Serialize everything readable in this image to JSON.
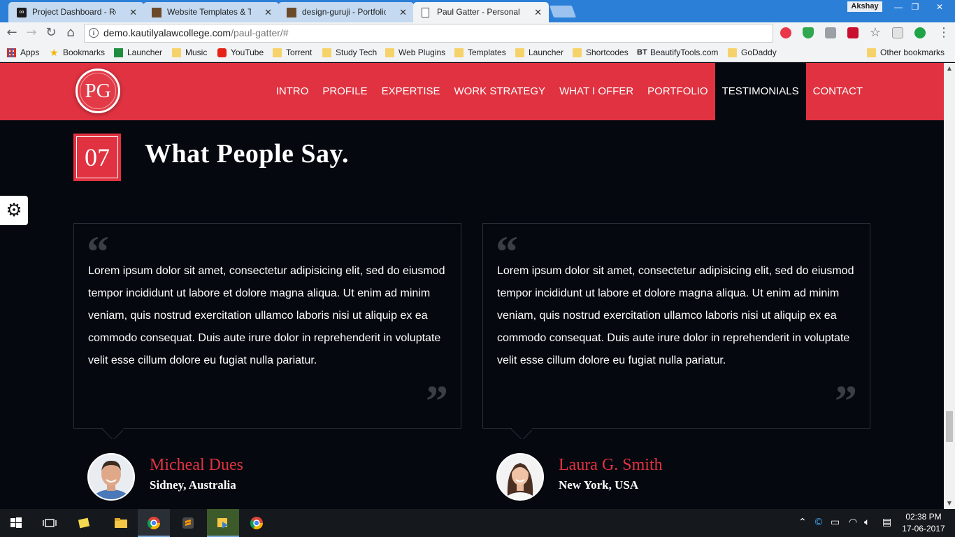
{
  "browser": {
    "tabs": [
      {
        "title": "Project Dashboard - Rob"
      },
      {
        "title": "Website Templates & Th"
      },
      {
        "title": "design-guruji - Portfolio"
      },
      {
        "title": "Paul Gatter - Personal Re"
      }
    ],
    "profile": "Akshay",
    "url_host": "demo.kautilyalawcollege.com",
    "url_path": "/paul-gatter/#",
    "bookmarks": [
      "Apps",
      "Bookmarks",
      "Launcher",
      "Music",
      "YouTube",
      "Torrent",
      "Study Tech",
      "Web Plugins",
      "Templates",
      "Launcher",
      "Shortcodes",
      "BeautifyTools.com",
      "GoDaddy"
    ],
    "other_bookmarks": "Other bookmarks"
  },
  "site": {
    "logo_text": "PG",
    "menu": [
      "INTRO",
      "PROFILE",
      "EXPERTISE",
      "WORK STRATEGY",
      "WHAT I OFFER",
      "PORTFOLIO",
      "TESTIMONIALS",
      "CONTACT"
    ],
    "active_menu": "TESTIMONIALS",
    "accent_color": "#e03240",
    "section_number": "07",
    "section_title": "What People Say.",
    "testimonials": [
      {
        "quote": "Lorem ipsum dolor sit amet, consectetur adipisicing elit, sed do eiusmod tempor incididunt ut labore et dolore magna aliqua. Ut enim ad minim veniam, quis nostrud exercitation ullamco laboris nisi ut aliquip ex ea commodo consequat. Duis aute irure dolor in reprehenderit in voluptate velit esse cillum dolore eu fugiat nulla pariatur.",
        "name": "Micheal Dues",
        "location": "Sidney, Australia"
      },
      {
        "quote": "Lorem ipsum dolor sit amet, consectetur adipisicing elit, sed do eiusmod tempor incididunt ut labore et dolore magna aliqua. Ut enim ad minim veniam, quis nostrud exercitation ullamco laboris nisi ut aliquip ex ea commodo consequat. Duis aute irure dolor in reprehenderit in voluptate velit esse cillum dolore eu fugiat nulla pariatur.",
        "name": "Laura G. Smith",
        "location": "New York, USA"
      }
    ]
  },
  "taskbar": {
    "time": "02:38 PM",
    "date": "17-06-2017"
  }
}
